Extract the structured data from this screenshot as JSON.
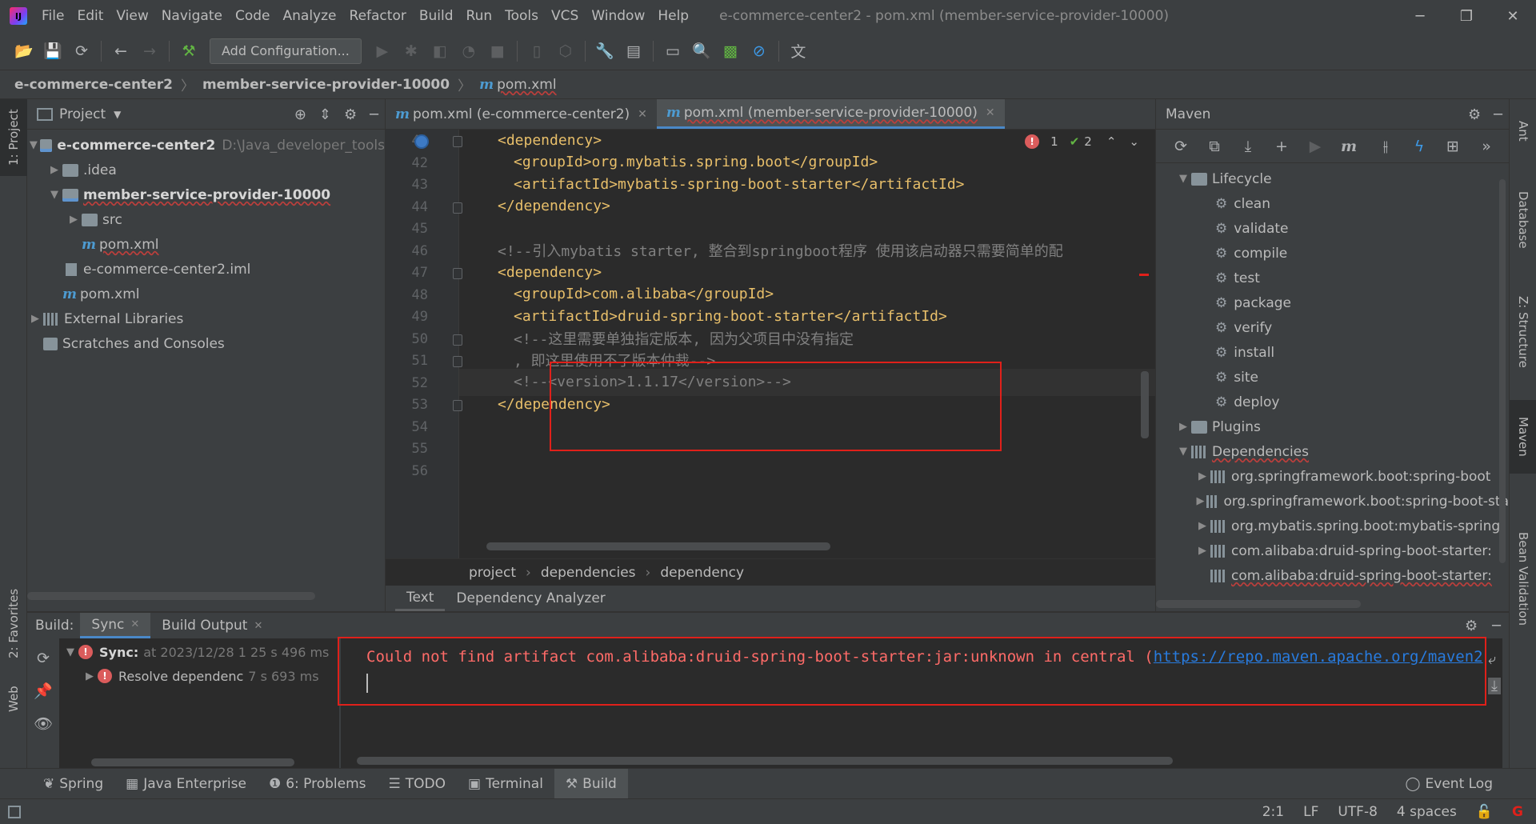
{
  "window": {
    "title": "e-commerce-center2 - pom.xml (member-service-provider-10000)",
    "menu": [
      "File",
      "Edit",
      "View",
      "Navigate",
      "Code",
      "Analyze",
      "Refactor",
      "Build",
      "Run",
      "Tools",
      "VCS",
      "Window",
      "Help"
    ]
  },
  "toolbar": {
    "add_config_label": "Add Configuration..."
  },
  "navbar": {
    "crumbs": [
      "e-commerce-center2",
      "member-service-provider-10000",
      "pom.xml"
    ]
  },
  "left_strip": {
    "project_tab": "1: Project",
    "favorites_tab": "2: Favorites",
    "web_tab": "Web"
  },
  "project": {
    "header": "Project",
    "items": [
      {
        "label": "e-commerce-center2",
        "path": "D:\\Java_developer_tools"
      },
      {
        "label": ".idea"
      },
      {
        "label": "member-service-provider-10000"
      },
      {
        "label": "src"
      },
      {
        "label": "pom.xml"
      },
      {
        "label": "e-commerce-center2.iml"
      },
      {
        "label": "pom.xml"
      },
      {
        "label": "External Libraries"
      },
      {
        "label": "Scratches and Consoles"
      }
    ]
  },
  "editor": {
    "tabs": [
      "pom.xml (e-commerce-center2)",
      "pom.xml (member-service-provider-10000)"
    ],
    "error_count": "1",
    "ok_count": "2",
    "lines": [
      {
        "n": "41",
        "text": "<dependency>"
      },
      {
        "n": "42",
        "text": "<groupId>org.mybatis.spring.boot</groupId>"
      },
      {
        "n": "43",
        "text": "<artifactId>mybatis-spring-boot-starter</artifactId>"
      },
      {
        "n": "44",
        "text": "</dependency>"
      },
      {
        "n": "45",
        "text": ""
      },
      {
        "n": "46",
        "text": "<!--引入mybatis starter, 整合到springboot程序 使用该启动器只需要简单的配"
      },
      {
        "n": "47",
        "text": "<dependency>"
      },
      {
        "n": "48",
        "text": "<groupId>com.alibaba</groupId>"
      },
      {
        "n": "49",
        "text": "<artifactId>druid-spring-boot-starter</artifactId>"
      },
      {
        "n": "50",
        "text": "<!--这里需要单独指定版本, 因为父项目中没有指定"
      },
      {
        "n": "51",
        "text": ", 即这里使用不了版本仲裁-->"
      },
      {
        "n": "52",
        "text": "<!--<version>1.1.17</version>-->"
      },
      {
        "n": "53",
        "text": "</dependency>"
      },
      {
        "n": "54",
        "text": ""
      },
      {
        "n": "55",
        "text": ""
      },
      {
        "n": "56",
        "text": ""
      }
    ],
    "breadcrumb": [
      "project",
      "dependencies",
      "dependency"
    ],
    "bottom_tabs": [
      "Text",
      "Dependency Analyzer"
    ]
  },
  "maven": {
    "header": "Maven",
    "lifecycle_label": "Lifecycle",
    "lifecycle": [
      "clean",
      "validate",
      "compile",
      "test",
      "package",
      "verify",
      "install",
      "site",
      "deploy"
    ],
    "plugins_label": "Plugins",
    "dependencies_label": "Dependencies",
    "dependencies": [
      "org.springframework.boot:spring-boot",
      "org.springframework.boot:spring-boot-sta",
      "org.mybatis.spring.boot:mybatis-spring",
      "com.alibaba:druid-spring-boot-starter:",
      "com.alibaba:druid-spring-boot-starter:"
    ]
  },
  "right_strip": {
    "tabs": [
      "Ant",
      "Database",
      "Z: Structure",
      "Maven",
      "Bean Validation"
    ]
  },
  "build": {
    "label": "Build:",
    "tabs": [
      "Sync",
      "Build Output"
    ],
    "sync_item": {
      "label": "Sync:",
      "detail": "at 2023/12/28 1 25 s 496 ms"
    },
    "resolve_item": {
      "label": "Resolve dependenc",
      "detail": "7 s 693 ms"
    },
    "error_text": "Could not find artifact com.alibaba:druid-spring-boot-starter:jar:unknown in central (",
    "error_link": "https://repo.maven.apache.org/maven2"
  },
  "bottom_tabs": [
    "Spring",
    "Java Enterprise",
    "6: Problems",
    "TODO",
    "Terminal",
    "Build",
    "Event Log"
  ],
  "status": {
    "position": "2:1",
    "line_sep": "LF",
    "encoding": "UTF-8",
    "indent": "4 spaces"
  },
  "colors": {
    "error": "#ff6b68",
    "link": "#287bde",
    "annotation_box": "#e0201a",
    "tag": "#e8bf6a",
    "comment": "#808080"
  }
}
